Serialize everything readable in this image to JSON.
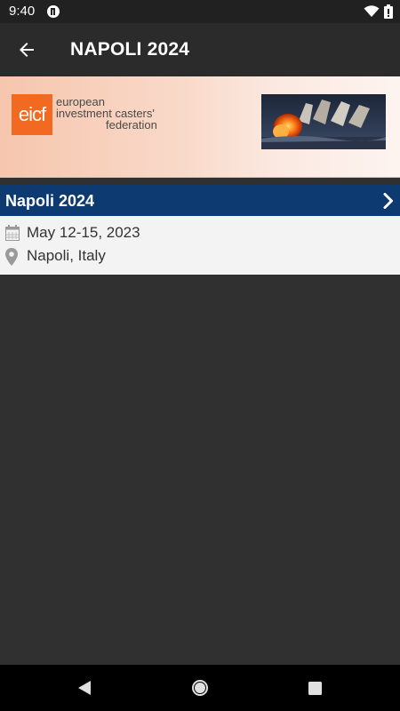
{
  "status_bar": {
    "time": "9:40",
    "icons": [
      "app-notification-icon",
      "wifi-icon",
      "battery-icon"
    ]
  },
  "app_bar": {
    "title": "NAPOLI 2024",
    "back_icon": "arrow-left-icon"
  },
  "banner": {
    "logo_mark": "eicf",
    "logo_lines": [
      "european",
      "investment casters'",
      "federation"
    ],
    "colors": {
      "logo_orange": "#f26a21"
    }
  },
  "event": {
    "name": "Napoli 2024",
    "date": "May 12-15, 2023",
    "location": "Napoli, Italy",
    "header_color": "#0d3a70"
  },
  "nav_bar": {
    "buttons": [
      "back",
      "home",
      "recents"
    ]
  }
}
